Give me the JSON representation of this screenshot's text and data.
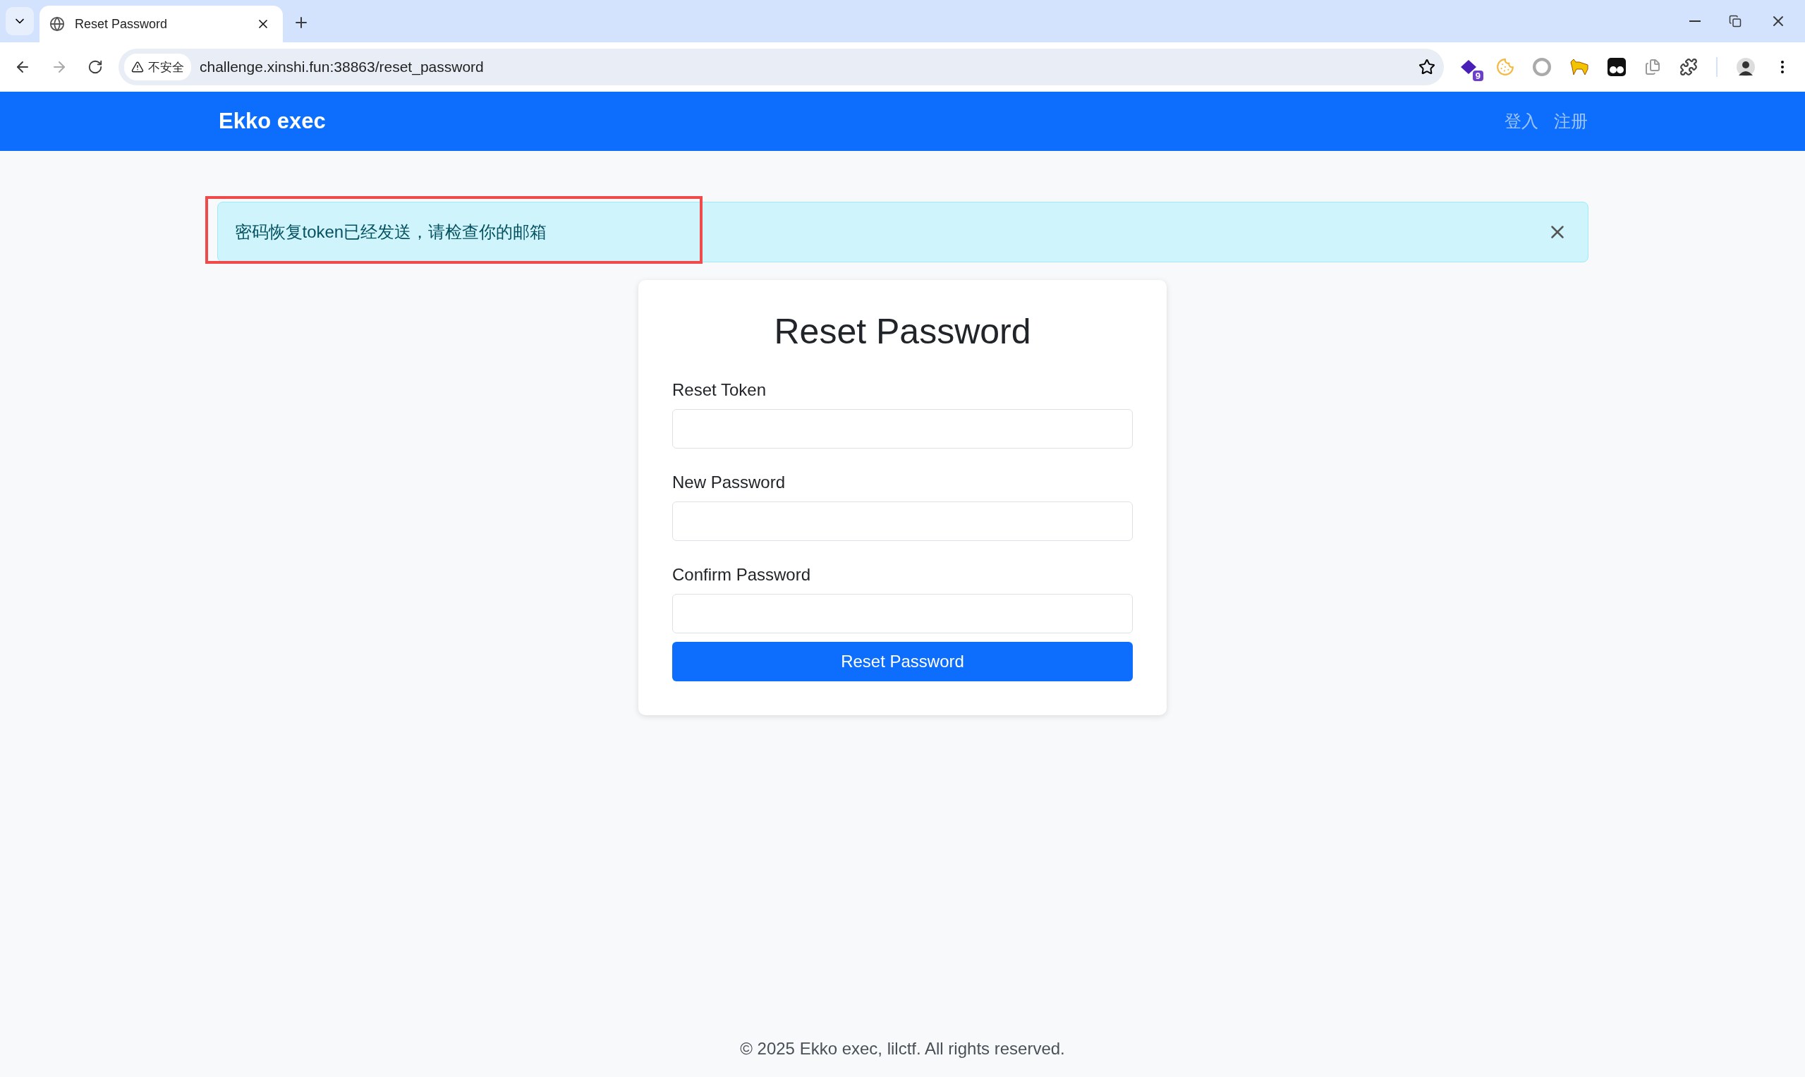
{
  "browser": {
    "tab_title": "Reset Password",
    "security_label": "不安全",
    "url": "challenge.xinshi.fun:38863/reset_password",
    "extension_badge": "9"
  },
  "navbar": {
    "brand": "Ekko exec",
    "links": [
      "登入",
      "注册"
    ]
  },
  "alert": {
    "message": "密码恢复token已经发送，请检查你的邮箱",
    "highlighted": true
  },
  "form": {
    "title": "Reset Password",
    "fields": [
      {
        "label": "Reset Token"
      },
      {
        "label": "New Password"
      },
      {
        "label": "Confirm Password"
      }
    ],
    "submit": "Reset Password"
  },
  "footer": "© 2025 Ekko exec, lilctf. All rights reserved."
}
